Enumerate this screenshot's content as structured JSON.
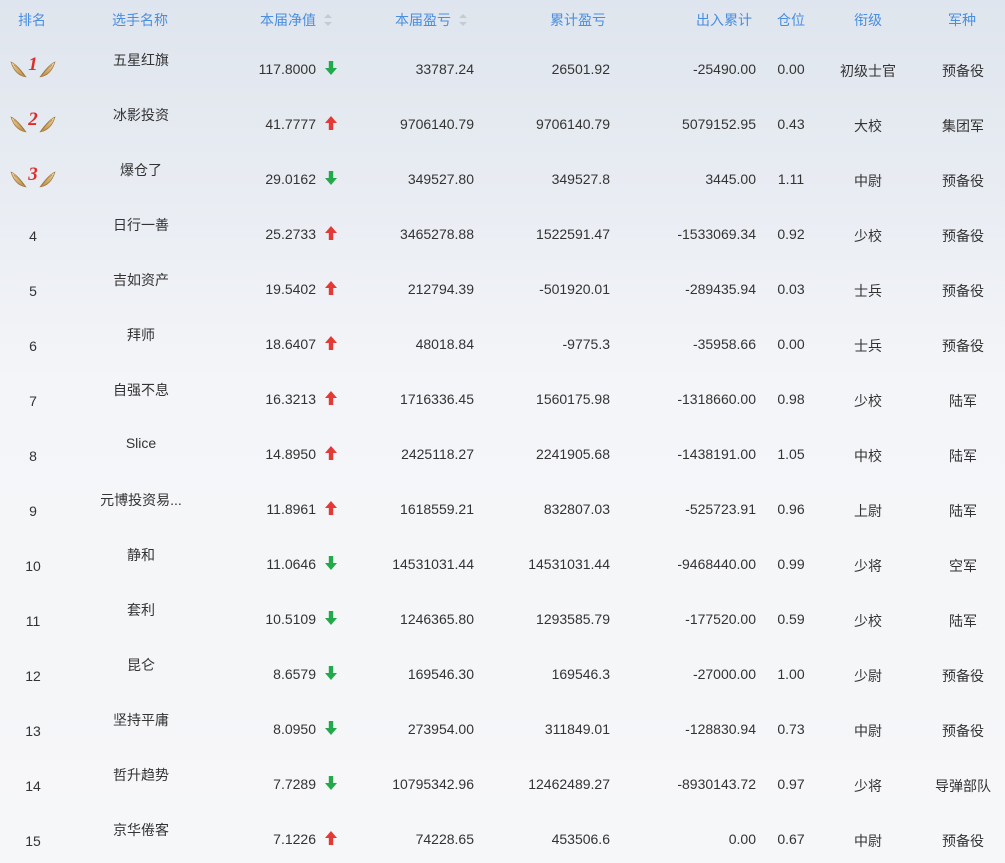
{
  "headers": {
    "rank": "排名",
    "name": "选手名称",
    "nav": "本届净值",
    "pl": "本届盈亏",
    "cum": "累计盈亏",
    "flow": "出入累计",
    "position": "仓位",
    "rank_title": "衔级",
    "arm": "军种"
  },
  "colors": {
    "header_text": "#4a8ee0",
    "up_arrow": "#e53935",
    "down_arrow": "#22a94a",
    "medal_number": "#e02b2b"
  },
  "rows": [
    {
      "rank": "1",
      "medal": true,
      "name": "五星红旗",
      "nav": "117.8000",
      "trend": "down",
      "pl": "33787.24",
      "cum": "26501.92",
      "flow": "-25490.00",
      "position": "0.00",
      "rank_title": "初级士官",
      "arm": "预备役"
    },
    {
      "rank": "2",
      "medal": true,
      "name": "冰影投资",
      "nav": "41.7777",
      "trend": "up",
      "pl": "9706140.79",
      "cum": "9706140.79",
      "flow": "5079152.95",
      "position": "0.43",
      "rank_title": "大校",
      "arm": "集团军"
    },
    {
      "rank": "3",
      "medal": true,
      "name": "爆仓了",
      "nav": "29.0162",
      "trend": "down",
      "pl": "349527.80",
      "cum": "349527.8",
      "flow": "3445.00",
      "position": "1.11",
      "rank_title": "中尉",
      "arm": "预备役"
    },
    {
      "rank": "4",
      "medal": false,
      "name": "日行一善",
      "nav": "25.2733",
      "trend": "up",
      "pl": "3465278.88",
      "cum": "1522591.47",
      "flow": "-1533069.34",
      "position": "0.92",
      "rank_title": "少校",
      "arm": "预备役"
    },
    {
      "rank": "5",
      "medal": false,
      "name": "吉如资产",
      "nav": "19.5402",
      "trend": "up",
      "pl": "212794.39",
      "cum": "-501920.01",
      "flow": "-289435.94",
      "position": "0.03",
      "rank_title": "士兵",
      "arm": "预备役"
    },
    {
      "rank": "6",
      "medal": false,
      "name": "拜师",
      "nav": "18.6407",
      "trend": "up",
      "pl": "48018.84",
      "cum": "-9775.3",
      "flow": "-35958.66",
      "position": "0.00",
      "rank_title": "士兵",
      "arm": "预备役"
    },
    {
      "rank": "7",
      "medal": false,
      "name": "自强不息",
      "nav": "16.3213",
      "trend": "up",
      "pl": "1716336.45",
      "cum": "1560175.98",
      "flow": "-1318660.00",
      "position": "0.98",
      "rank_title": "少校",
      "arm": "陆军"
    },
    {
      "rank": "8",
      "medal": false,
      "name": "Slice",
      "nav": "14.8950",
      "trend": "up",
      "pl": "2425118.27",
      "cum": "2241905.68",
      "flow": "-1438191.00",
      "position": "1.05",
      "rank_title": "中校",
      "arm": "陆军"
    },
    {
      "rank": "9",
      "medal": false,
      "name": "元博投资易...",
      "nav": "11.8961",
      "trend": "up",
      "pl": "1618559.21",
      "cum": "832807.03",
      "flow": "-525723.91",
      "position": "0.96",
      "rank_title": "上尉",
      "arm": "陆军"
    },
    {
      "rank": "10",
      "medal": false,
      "name": "静和",
      "nav": "11.0646",
      "trend": "down",
      "pl": "14531031.44",
      "cum": "14531031.44",
      "flow": "-9468440.00",
      "position": "0.99",
      "rank_title": "少将",
      "arm": "空军"
    },
    {
      "rank": "11",
      "medal": false,
      "name": "套利",
      "nav": "10.5109",
      "trend": "down",
      "pl": "1246365.80",
      "cum": "1293585.79",
      "flow": "-177520.00",
      "position": "0.59",
      "rank_title": "少校",
      "arm": "陆军"
    },
    {
      "rank": "12",
      "medal": false,
      "name": "昆仑",
      "nav": "8.6579",
      "trend": "down",
      "pl": "169546.30",
      "cum": "169546.3",
      "flow": "-27000.00",
      "position": "1.00",
      "rank_title": "少尉",
      "arm": "预备役"
    },
    {
      "rank": "13",
      "medal": false,
      "name": "坚持平庸",
      "nav": "8.0950",
      "trend": "down",
      "pl": "273954.00",
      "cum": "311849.01",
      "flow": "-128830.94",
      "position": "0.73",
      "rank_title": "中尉",
      "arm": "预备役"
    },
    {
      "rank": "14",
      "medal": false,
      "name": "哲升趋势",
      "nav": "7.7289",
      "trend": "down",
      "pl": "10795342.96",
      "cum": "12462489.27",
      "flow": "-8930143.72",
      "position": "0.97",
      "rank_title": "少将",
      "arm": "导弹部队"
    },
    {
      "rank": "15",
      "medal": false,
      "name": "京华倦客",
      "nav": "7.1226",
      "trend": "up",
      "pl": "74228.65",
      "cum": "453506.6",
      "flow": "0.00",
      "position": "0.67",
      "rank_title": "中尉",
      "arm": "预备役"
    }
  ]
}
